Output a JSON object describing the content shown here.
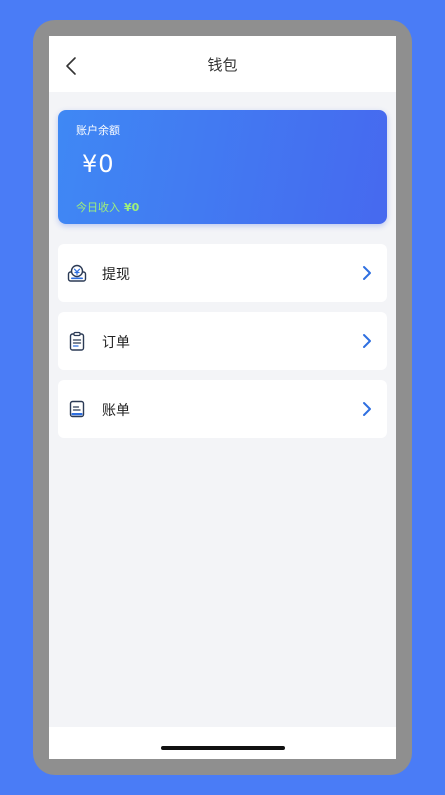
{
  "nav": {
    "title": "钱包"
  },
  "balance": {
    "label": "账户余额",
    "amount": "¥0",
    "today_label": "今日收入",
    "today_value": "¥0"
  },
  "menu": [
    {
      "label": "提现",
      "icon": "withdraw-icon"
    },
    {
      "label": "订单",
      "icon": "order-icon"
    },
    {
      "label": "账单",
      "icon": "bill-icon"
    }
  ],
  "colors": {
    "background": "#4a7cf6",
    "card_gradient_start": "#3f88f4",
    "card_gradient_end": "#4669ef",
    "income": "#9ff07a",
    "chevron": "#2f6fe0"
  }
}
